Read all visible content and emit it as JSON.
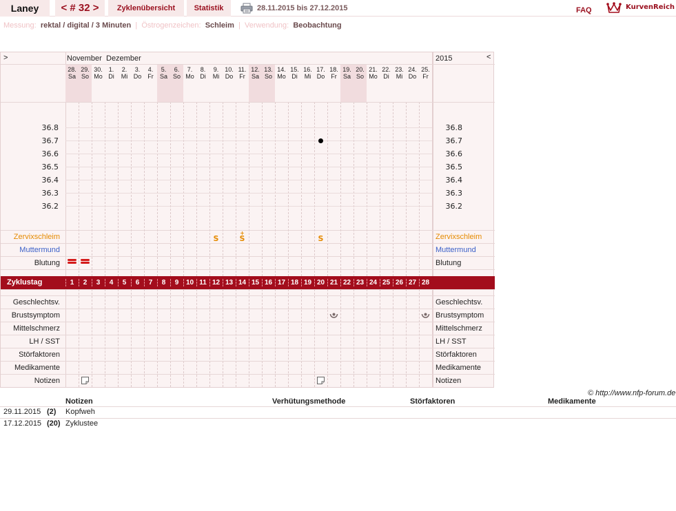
{
  "topbar": {
    "user": "Laney",
    "cycle": "< # 32 >",
    "overview": "Zyklenübersicht",
    "statistics": "Statistik",
    "date_range": "28.11.2015 bis 27.12.2015",
    "faq": "FAQ",
    "brand": "KurvenReich"
  },
  "info": {
    "measurement_label": "Messung:",
    "measurement_value": "rektal / digital / 3 Minuten",
    "estrogen_label": "Östrogenzeichen:",
    "estrogen_value": "Schleim",
    "usage_label": "Verwendung:",
    "usage_value": "Beobachtung",
    "separator": "|"
  },
  "chart": {
    "nav_prev": ">",
    "nav_next": "<",
    "month1": "November",
    "month2": "Dezember",
    "year": "2015",
    "days": [
      {
        "d": "28.",
        "w": "Sa",
        "weekend": true
      },
      {
        "d": "29.",
        "w": "So",
        "weekend": true
      },
      {
        "d": "30.",
        "w": "Mo",
        "weekend": false
      },
      {
        "d": "1.",
        "w": "Di",
        "weekend": false
      },
      {
        "d": "2.",
        "w": "Mi",
        "weekend": false
      },
      {
        "d": "3.",
        "w": "Do",
        "weekend": false
      },
      {
        "d": "4.",
        "w": "Fr",
        "weekend": false
      },
      {
        "d": "5.",
        "w": "Sa",
        "weekend": true
      },
      {
        "d": "6.",
        "w": "So",
        "weekend": true
      },
      {
        "d": "7.",
        "w": "Mo",
        "weekend": false
      },
      {
        "d": "8.",
        "w": "Di",
        "weekend": false
      },
      {
        "d": "9.",
        "w": "Mi",
        "weekend": false
      },
      {
        "d": "10.",
        "w": "Do",
        "weekend": false
      },
      {
        "d": "11.",
        "w": "Fr",
        "weekend": false
      },
      {
        "d": "12.",
        "w": "Sa",
        "weekend": true
      },
      {
        "d": "13.",
        "w": "So",
        "weekend": true
      },
      {
        "d": "14.",
        "w": "Mo",
        "weekend": false
      },
      {
        "d": "15.",
        "w": "Di",
        "weekend": false
      },
      {
        "d": "16.",
        "w": "Mi",
        "weekend": false
      },
      {
        "d": "17.",
        "w": "Do",
        "weekend": false
      },
      {
        "d": "18.",
        "w": "Fr",
        "weekend": false
      },
      {
        "d": "19.",
        "w": "Sa",
        "weekend": true
      },
      {
        "d": "20.",
        "w": "So",
        "weekend": true
      },
      {
        "d": "21.",
        "w": "Mo",
        "weekend": false
      },
      {
        "d": "22.",
        "w": "Di",
        "weekend": false
      },
      {
        "d": "23.",
        "w": "Mi",
        "weekend": false
      },
      {
        "d": "24.",
        "w": "Do",
        "weekend": false
      },
      {
        "d": "25.",
        "w": "Fr",
        "weekend": false
      }
    ],
    "temperatures": [
      "36.8",
      "36.7",
      "36.6",
      "36.5",
      "36.4",
      "36.3",
      "36.2"
    ],
    "temperature_points": [
      {
        "cycle_day": 20,
        "value": 36.7
      }
    ],
    "cervix_marks": [
      {
        "cycle_day": 12,
        "symbol": "S"
      },
      {
        "cycle_day": 14,
        "symbol": "S+"
      },
      {
        "cycle_day": 20,
        "symbol": "S"
      }
    ],
    "bleeding_days": [
      1,
      2
    ],
    "breast_symptom_days": [
      21,
      28
    ],
    "note_days": [
      2,
      20
    ],
    "row_labels": {
      "cervix": "Zervixschleim",
      "os": "Muttermund",
      "bleeding": "Blutung",
      "cycle_day": "Zyklustag",
      "intercourse": "Geschlechtsv.",
      "breast": "Brustsymptom",
      "midpain": "Mittelschmerz",
      "lh": "LH / SST",
      "disturb": "Störfaktoren",
      "meds": "Medikamente",
      "notes": "Notizen"
    },
    "colors": {
      "accent": "#a30d1c",
      "cervix": "#e58a00",
      "os": "#3a5fc8",
      "bleeding": "#d41a1a",
      "weekend_shade": "#f1dcde"
    }
  },
  "notes": {
    "copyright": "© http://www.nfp-forum.de",
    "headers": [
      "Notizen",
      "Verhütungsmethode",
      "Störfaktoren",
      "Medikamente"
    ],
    "rows": [
      {
        "date": "29.11.2015",
        "day": "(2)",
        "note": "Kopfweh"
      },
      {
        "date": "17.12.2015",
        "day": "(20)",
        "note": "Zyklustee"
      }
    ]
  }
}
